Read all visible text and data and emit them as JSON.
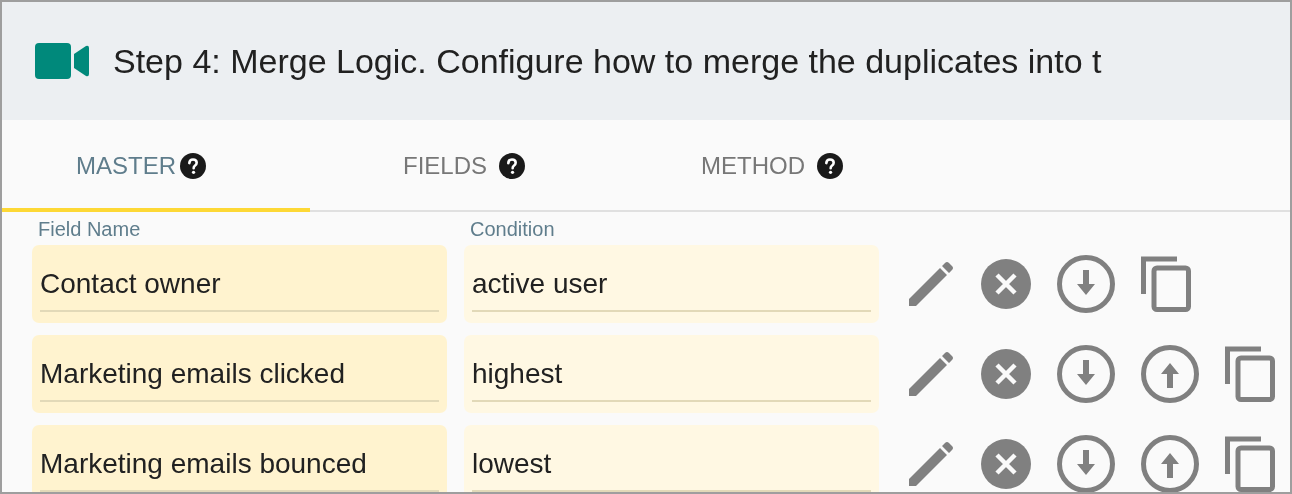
{
  "header": {
    "title": "Step 4: Merge Logic. Configure how to merge the duplicates into t"
  },
  "tabs": [
    {
      "label": "MASTER",
      "selected": true
    },
    {
      "label": "FIELDS",
      "selected": false
    },
    {
      "label": "METHOD",
      "selected": false
    }
  ],
  "columns": [
    "Field Name",
    "Condition"
  ],
  "rows": [
    {
      "field_name": "Contact owner",
      "condition": "active user",
      "actions": [
        {
          "kind": "edit"
        },
        {
          "kind": "remove"
        },
        {
          "kind": "move_down"
        },
        {
          "kind": "copy"
        }
      ]
    },
    {
      "field_name": "Marketing emails clicked",
      "condition": "highest",
      "actions": [
        {
          "kind": "edit"
        },
        {
          "kind": "remove"
        },
        {
          "kind": "move_down"
        },
        {
          "kind": "move_up"
        },
        {
          "kind": "copy"
        }
      ]
    },
    {
      "field_name": "Marketing emails bounced",
      "condition": "lowest",
      "actions": [
        {
          "kind": "edit"
        },
        {
          "kind": "remove"
        },
        {
          "kind": "move_down"
        },
        {
          "kind": "move_up"
        },
        {
          "kind": "copy"
        }
      ]
    }
  ]
}
